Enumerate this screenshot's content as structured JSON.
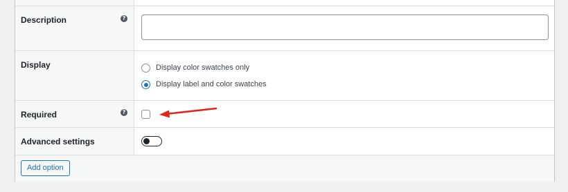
{
  "form": {
    "rows": {
      "description": {
        "label": "Description",
        "help_icon": "help-icon",
        "value": ""
      },
      "display": {
        "label": "Display",
        "options": [
          {
            "label": "Display color swatches only",
            "checked": false
          },
          {
            "label": "Display label and color swatches",
            "checked": true
          }
        ]
      },
      "required": {
        "label": "Required",
        "help_icon": "help-icon",
        "checked": false
      },
      "advanced": {
        "label": "Advanced settings",
        "toggle_on": false
      }
    },
    "footer": {
      "add_option_label": "Add option"
    }
  },
  "colors": {
    "accent": "#2271b1",
    "annotation_arrow": "#e2231a",
    "label_column_bg": "#f6f7f7",
    "page_bg": "#f0f0f1"
  }
}
